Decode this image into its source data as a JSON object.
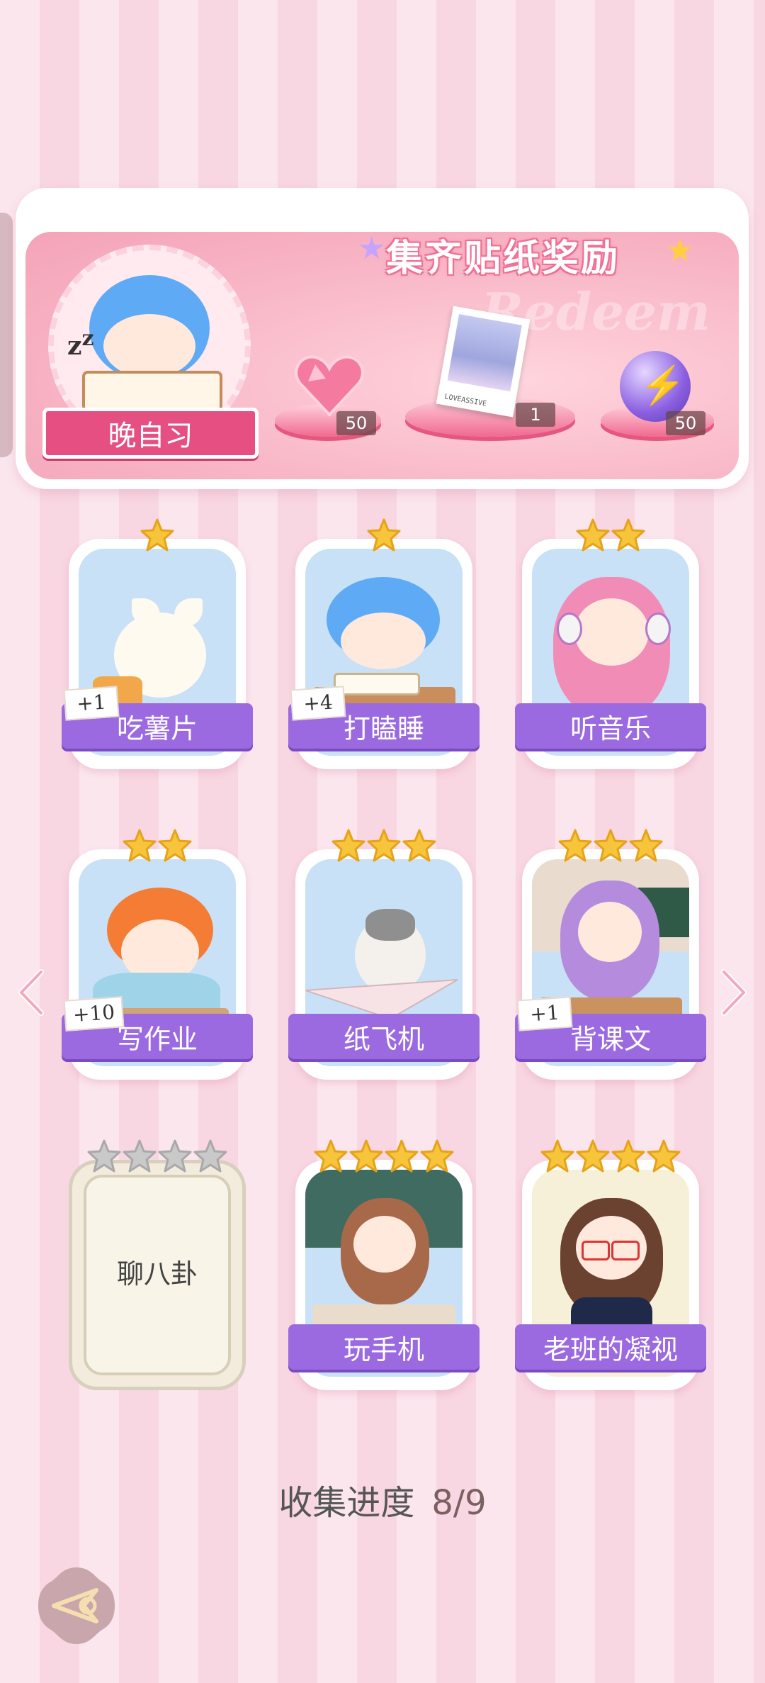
{
  "reward": {
    "title": "集齐贴纸奖励",
    "watermark": "Redeem",
    "avatar_label": "晚自习",
    "items": [
      {
        "icon": "heart-gem-icon",
        "count": "50"
      },
      {
        "icon": "photo-card-icon",
        "count": "1",
        "caption": "LOVEASSIVE"
      },
      {
        "icon": "lightning-orb-icon",
        "count": "50"
      }
    ]
  },
  "cards": [
    {
      "name": "吃薯片",
      "stars": 1,
      "bonus": "+1",
      "locked": false,
      "art": "white-cat-eating-chips"
    },
    {
      "name": "打瞌睡",
      "stars": 1,
      "bonus": "+4",
      "locked": false,
      "art": "blue-hair-boy-sleeping"
    },
    {
      "name": "听音乐",
      "stars": 2,
      "bonus": "",
      "locked": false,
      "art": "pink-hair-girl-headphones"
    },
    {
      "name": "写作业",
      "stars": 2,
      "bonus": "+10",
      "locked": false,
      "art": "orange-hair-boy-writing"
    },
    {
      "name": "纸飞机",
      "stars": 3,
      "bonus": "",
      "locked": false,
      "art": "cat-on-paper-plane"
    },
    {
      "name": "背课文",
      "stars": 3,
      "bonus": "+1",
      "locked": false,
      "art": "purple-hair-girl-reading"
    },
    {
      "name": "聊八卦",
      "stars": 4,
      "bonus": "",
      "locked": true,
      "art": ""
    },
    {
      "name": "玩手机",
      "stars": 4,
      "bonus": "",
      "locked": false,
      "art": "brown-hair-girl-phone"
    },
    {
      "name": "老班的凝视",
      "stars": 4,
      "bonus": "",
      "locked": false,
      "art": "teacher-with-glasses"
    }
  ],
  "progress": {
    "label": "收集进度",
    "value": "8/9",
    "collected": 8,
    "total": 9
  },
  "colors": {
    "card_label": "#9b6ae0",
    "ribbon": "#e64f82",
    "star_gold": "#f7c53b",
    "star_gray": "#c9c9c9"
  }
}
